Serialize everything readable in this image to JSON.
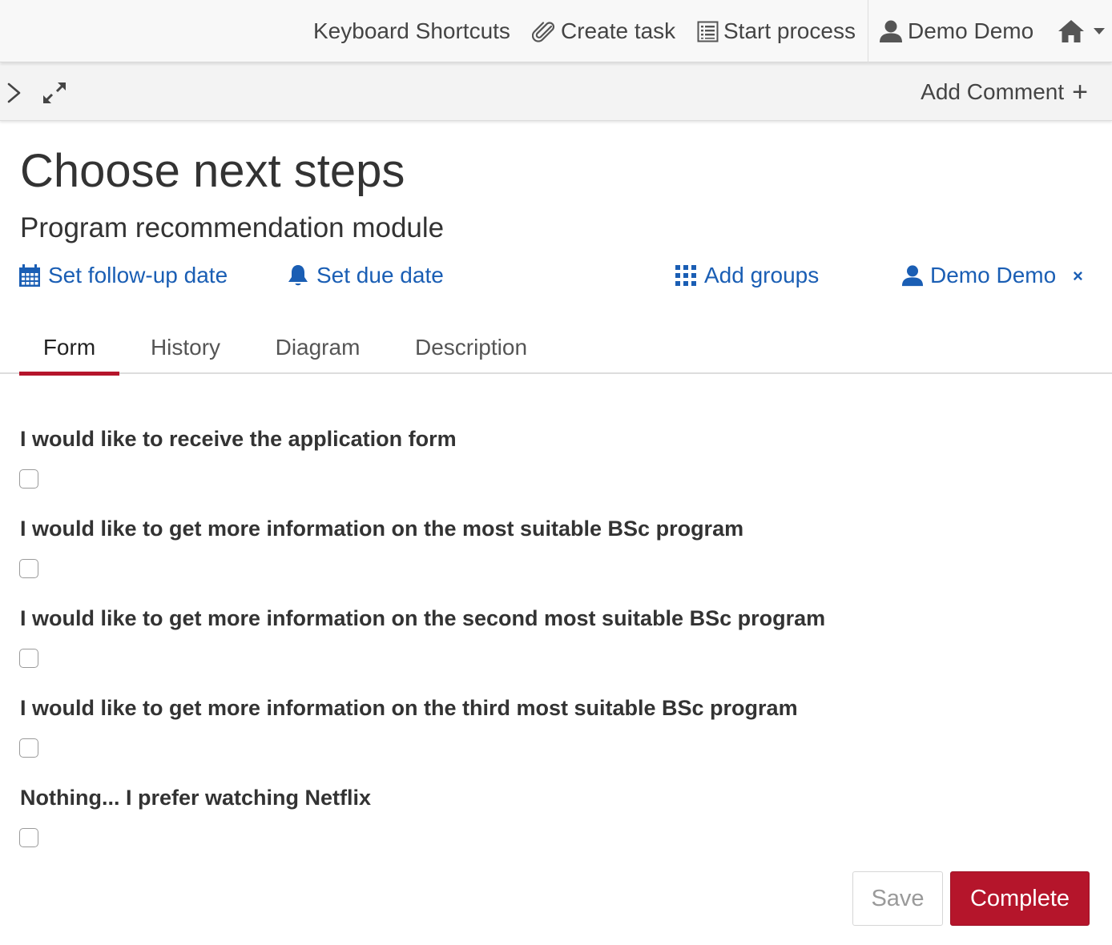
{
  "navbar": {
    "keyboard_shortcuts": "Keyboard Shortcuts",
    "create_task": "Create task",
    "start_process": "Start process",
    "user": "Demo Demo",
    "icons": [
      "paperclip-icon",
      "list-icon",
      "user-icon",
      "home-icon",
      "caret-down-icon"
    ]
  },
  "toolbar": {
    "add_comment": "Add Comment",
    "add_comment_plus": "+",
    "icons": [
      "chevron-right-icon",
      "expand-icon"
    ]
  },
  "task": {
    "title": "Choose next steps",
    "subtitle": "Program recommendation module",
    "follow_up_link": "Set follow-up date",
    "due_date_link": "Set due date",
    "groups_link": "Add groups",
    "assignee": "Demo Demo",
    "remove_assignee": "×"
  },
  "tabs": [
    {
      "label": "Form",
      "active": true
    },
    {
      "label": "History",
      "active": false
    },
    {
      "label": "Diagram",
      "active": false
    },
    {
      "label": "Description",
      "active": false
    }
  ],
  "form": {
    "fields": [
      {
        "label": "I would like to receive the application form",
        "checked": false
      },
      {
        "label": "I would like to get more information on the most suitable BSc program",
        "checked": false
      },
      {
        "label": "I would like to get more information on the second most suitable BSc program",
        "checked": false
      },
      {
        "label": "I would like to get more information on the third most suitable BSc program",
        "checked": false
      },
      {
        "label": "Nothing... I prefer watching Netflix",
        "checked": false
      }
    ],
    "save_label": "Save",
    "complete_label": "Complete"
  },
  "colors": {
    "link": "#1a5eb4",
    "accent": "#b5152b",
    "navbar_bg": "#f8f8f8"
  }
}
